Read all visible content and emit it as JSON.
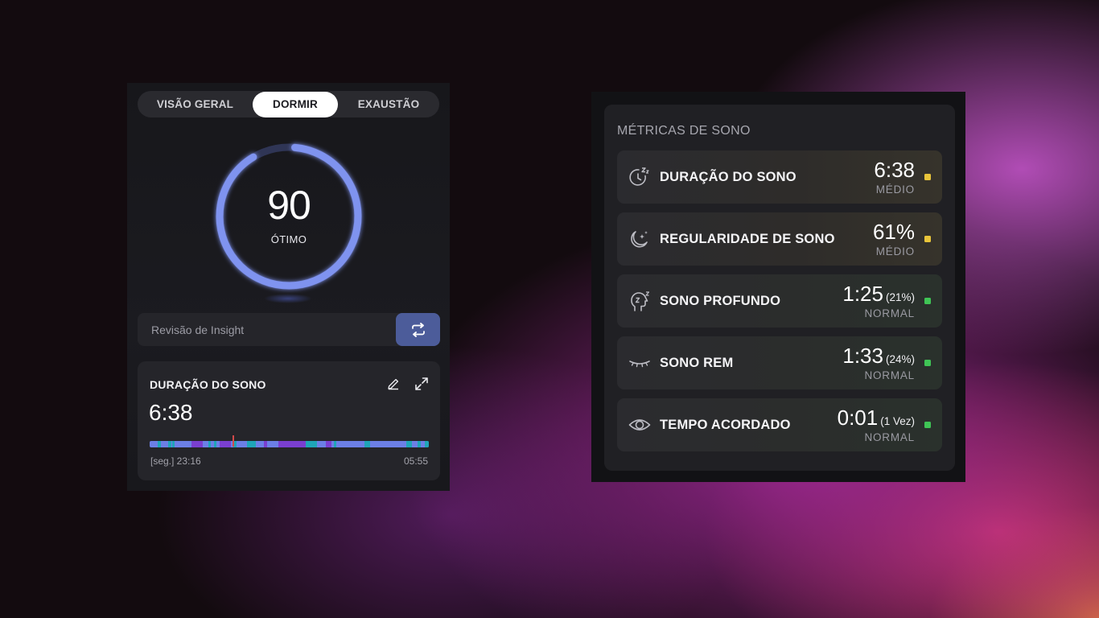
{
  "left_panel": {
    "tabs": [
      {
        "label": "VISÃO GERAL"
      },
      {
        "label": "DORMIR"
      },
      {
        "label": "EXAUSTÃO"
      }
    ],
    "active_tab": "DORMIR",
    "score": {
      "value": "90",
      "label": "ÓTIMO",
      "ring_progress": 0.9
    },
    "insight": {
      "placeholder": "Revisão de Insight",
      "button_icon": "repeat-icon"
    },
    "sleep_duration_card": {
      "title": "DURAÇÃO DO SONO",
      "value": "6:38",
      "start_label": "[seg.] 23:16",
      "end_label": "05:55",
      "edit_icon": "pencil-icon",
      "expand_icon": "expand-icon"
    }
  },
  "right_panel": {
    "title": "MÉTRICAS DE SONO",
    "metrics": [
      {
        "label": "DURAÇÃO DO SONO",
        "value": "6:38",
        "extra": "",
        "status": "MÉDIO",
        "indicator_color": "#e9c53a",
        "icon": "clock-sleep-icon"
      },
      {
        "label": "REGULARIDADE DE SONO",
        "value": "61%",
        "extra": "",
        "status": "MÉDIO",
        "indicator_color": "#e9c53a",
        "icon": "moon-stars-icon"
      },
      {
        "label": "SONO PROFUNDO",
        "value": "1:25",
        "extra": "(21%)",
        "status": "NORMAL",
        "indicator_color": "#3fc455",
        "icon": "head-sleep-icon"
      },
      {
        "label": "SONO REM",
        "value": "1:33",
        "extra": "(24%)",
        "status": "NORMAL",
        "indicator_color": "#3fc455",
        "icon": "closed-eye-icon"
      },
      {
        "label": "TEMPO ACORDADO",
        "value": "0:01",
        "extra": "(1 Vez)",
        "status": "NORMAL",
        "indicator_color": "#3fc455",
        "icon": "eye-icon"
      }
    ]
  },
  "colors": {
    "ring": "#7f93ef",
    "ring_track": "#2f3555",
    "timeline_light": "#6c7fe6",
    "timeline_deep": "#7a3fd0",
    "timeline_awake": "#1fa5b8",
    "insight_button": "#4c5c9a"
  }
}
